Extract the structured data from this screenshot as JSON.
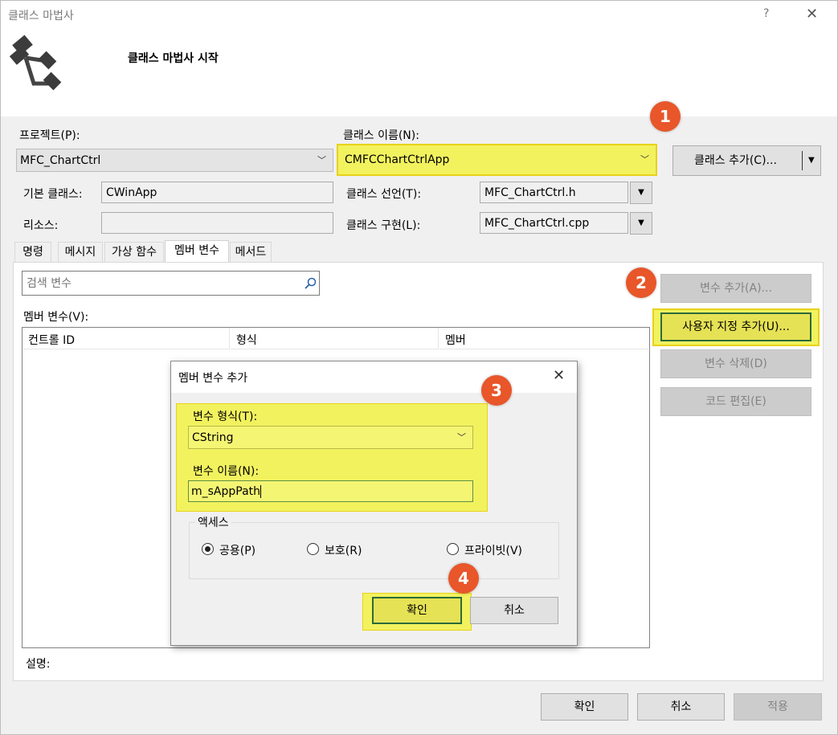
{
  "window": {
    "title": "클래스 마법사",
    "help": "?",
    "close": "✕"
  },
  "banner": {
    "heading": "클래스 마법사 시작"
  },
  "project": {
    "label": "프로젝트(P):",
    "value": "MFC_ChartCtrl"
  },
  "class_name": {
    "label": "클래스 이름(N):",
    "value": "CMFCChartCtrlApp"
  },
  "add_class_button": "클래스 추가(C)...",
  "base_class": {
    "label": "기본 클래스:",
    "value": "CWinApp"
  },
  "resource": {
    "label": "리소스:",
    "value": ""
  },
  "class_decl": {
    "label": "클래스 선언(T):",
    "value": "MFC_ChartCtrl.h"
  },
  "class_impl": {
    "label": "클래스 구현(L):",
    "value": "MFC_ChartCtrl.cpp"
  },
  "tabs": [
    "명령",
    "메시지",
    "가상 함수",
    "멤버 변수",
    "메서드"
  ],
  "search": {
    "placeholder": "검색 변수"
  },
  "member_list": {
    "label": "멤버 변수(V):",
    "columns": [
      "컨트롤 ID",
      "형식",
      "멤버"
    ]
  },
  "side_buttons": {
    "add_var": "변수 추가(A)...",
    "add_custom": "사용자 지정 추가(U)...",
    "delete_var": "변수 삭제(D)",
    "edit_code": "코드 편집(E)"
  },
  "description_label": "설명:",
  "footer": {
    "ok": "확인",
    "cancel": "취소",
    "apply": "적용"
  },
  "dialog": {
    "title": "멤버 변수 추가",
    "close": "✕",
    "type_label": "변수 형식(T):",
    "type_value": "CString",
    "name_label": "변수 이름(N):",
    "name_value": "m_sAppPath",
    "access_label": "액세스",
    "access_options": [
      "공용(P)",
      "보호(R)",
      "프라이빗(V)"
    ],
    "ok": "확인",
    "cancel": "취소"
  },
  "badges": [
    "1",
    "2",
    "3",
    "4"
  ]
}
